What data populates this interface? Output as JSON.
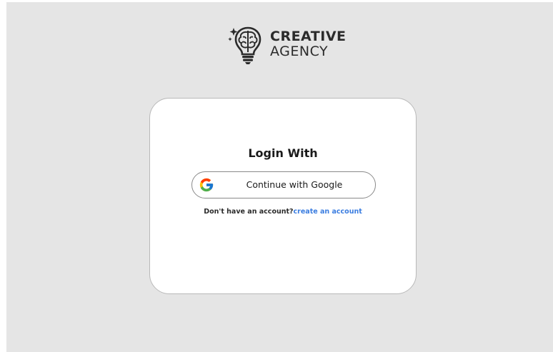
{
  "brand": {
    "name_line1": "CREATIVE",
    "name_line2": "AGENCY",
    "logo_icon": "brain-lightbulb-icon"
  },
  "login": {
    "title": "Login With",
    "google_button_label": "Continue with Google",
    "google_icon": "google-icon",
    "signup_prompt": "Don't have an account?",
    "signup_link": "create an account"
  },
  "colors": {
    "background": "#e5e5e5",
    "card": "#ffffff",
    "link": "#3b7de0",
    "text": "#1a1a1a"
  }
}
